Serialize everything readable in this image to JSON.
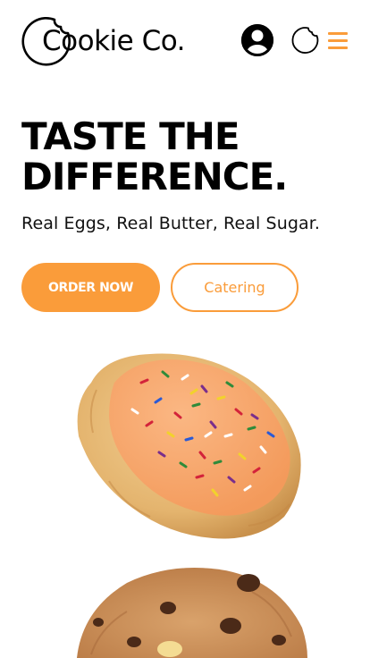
{
  "header": {
    "logo_text": "Cookie Co.",
    "icons": {
      "account": "user-circle-icon",
      "cookie": "cookie-outline-icon",
      "menu": "hamburger-menu-icon"
    }
  },
  "hero": {
    "headline_line1": "TASTE THE",
    "headline_line2": "DIFFERENCE.",
    "subtitle": "Real Eggs, Real Butter, Real Sugar.",
    "order_button": "ORDER NOW",
    "catering_button": "Catering"
  },
  "colors": {
    "accent": "#fa9c3a",
    "text": "#000000",
    "background": "#ffffff"
  },
  "images": [
    {
      "name": "frosted sugar cookie with sprinkles"
    },
    {
      "name": "chocolate chip cookie"
    }
  ]
}
